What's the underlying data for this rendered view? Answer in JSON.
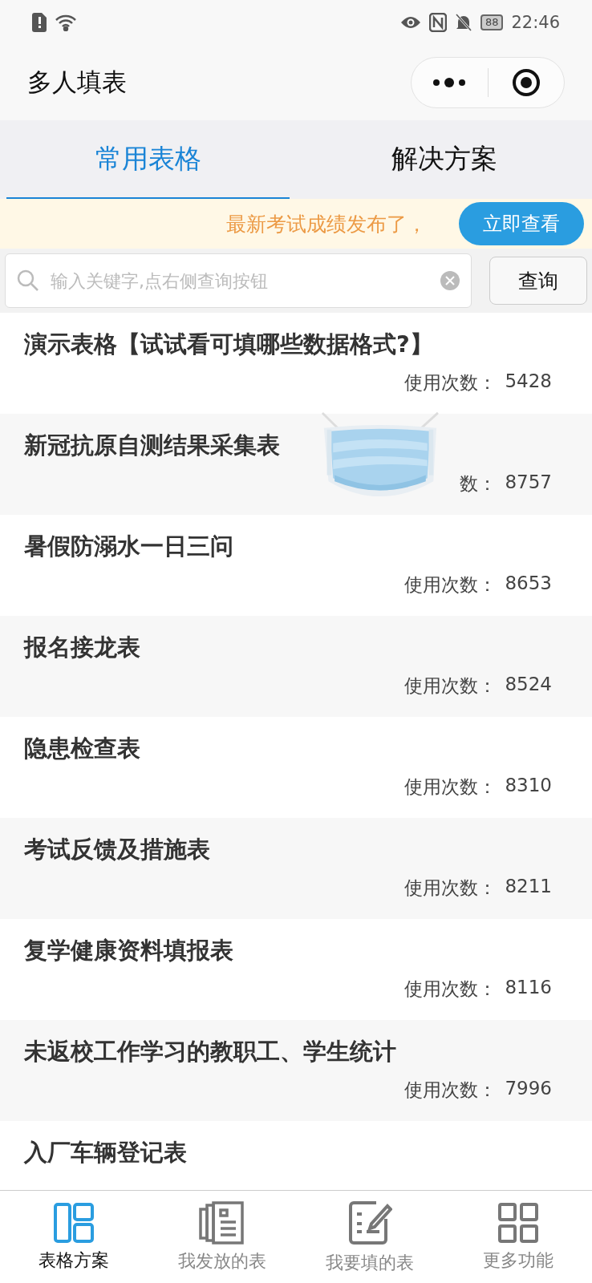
{
  "status_bar": {
    "time": "22:46",
    "battery": "88"
  },
  "header": {
    "title": "多人填表"
  },
  "tabs": [
    {
      "label": "常用表格",
      "selected": true
    },
    {
      "label": "解决方案",
      "selected": false
    }
  ],
  "notice": {
    "text": "最新考试成绩发布了，",
    "button": "立即查看"
  },
  "search": {
    "placeholder": "输入关键字,点右侧查询按钮",
    "button": "查询"
  },
  "rows": [
    {
      "title": "演示表格【试试看可填哪些数据格式?】",
      "label": "使用次数：",
      "count": "5428"
    },
    {
      "title": "新冠抗原自测结果采集表",
      "label": "数：",
      "count": "8757"
    },
    {
      "title": "暑假防溺水一日三问",
      "label": "使用次数：",
      "count": "8653"
    },
    {
      "title": "报名接龙表",
      "label": "使用次数：",
      "count": "8524"
    },
    {
      "title": "隐患检查表",
      "label": "使用次数：",
      "count": "8310"
    },
    {
      "title": "考试反馈及措施表",
      "label": "使用次数：",
      "count": "8211"
    },
    {
      "title": "复学健康资料填报表",
      "label": "使用次数：",
      "count": "8116"
    },
    {
      "title": "未返校工作学习的教职工、学生统计",
      "label": "使用次数：",
      "count": "7996"
    },
    {
      "title": "入厂车辆登记表"
    }
  ],
  "nav": [
    {
      "label": "表格方案",
      "kind": "layout",
      "selected": true
    },
    {
      "label": "我发放的表",
      "kind": "docs",
      "selected": false
    },
    {
      "label": "我要填的表",
      "kind": "edit",
      "selected": false
    },
    {
      "label": "更多功能",
      "kind": "grid",
      "selected": false
    }
  ]
}
